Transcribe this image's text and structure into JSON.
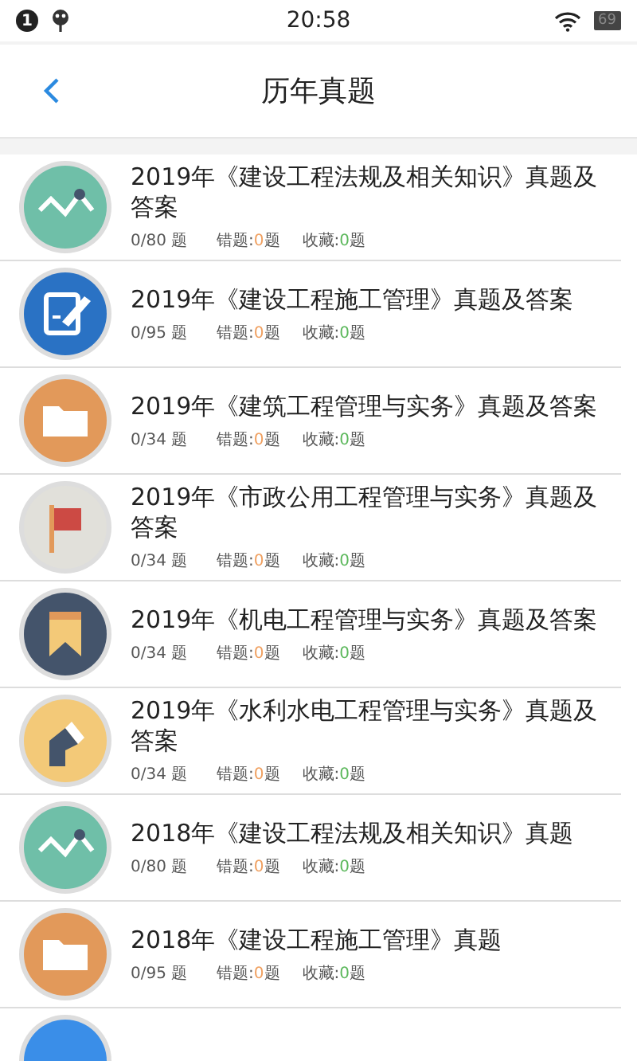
{
  "status_bar": {
    "notification_count": "1",
    "time": "20:58",
    "battery": "69"
  },
  "nav": {
    "title": "历年真题"
  },
  "items": [
    {
      "kind": "chart",
      "title": "2019年《建设工程法规及相关知识》真题及答案",
      "total": "0/80 题",
      "wrong": {
        "label": "错题:",
        "count": "0",
        "unit": "题"
      },
      "fav": {
        "label": "收藏:",
        "count": "0",
        "unit": "题"
      }
    },
    {
      "kind": "edit",
      "title": "2019年《建设工程施工管理》真题及答案",
      "total": "0/95 题",
      "wrong": {
        "label": "错题:",
        "count": "0",
        "unit": "题"
      },
      "fav": {
        "label": "收藏:",
        "count": "0",
        "unit": "题"
      }
    },
    {
      "kind": "folder",
      "title": "2019年《建筑工程管理与实务》真题及答案",
      "total": "0/34 题",
      "wrong": {
        "label": "错题:",
        "count": "0",
        "unit": "题"
      },
      "fav": {
        "label": "收藏:",
        "count": "0",
        "unit": "题"
      }
    },
    {
      "kind": "flag",
      "title": "2019年《市政公用工程管理与实务》真题及答案",
      "total": "0/34 题",
      "wrong": {
        "label": "错题:",
        "count": "0",
        "unit": "题"
      },
      "fav": {
        "label": "收藏:",
        "count": "0",
        "unit": "题"
      }
    },
    {
      "kind": "bookmark",
      "title": "2019年《机电工程管理与实务》真题及答案",
      "total": "0/34 题",
      "wrong": {
        "label": "错题:",
        "count": "0",
        "unit": "题"
      },
      "fav": {
        "label": "收藏:",
        "count": "0",
        "unit": "题"
      }
    },
    {
      "kind": "pipe",
      "title": "2019年《水利水电工程管理与实务》真题及答案",
      "total": "0/34 题",
      "wrong": {
        "label": "错题:",
        "count": "0",
        "unit": "题"
      },
      "fav": {
        "label": "收藏:",
        "count": "0",
        "unit": "题"
      }
    },
    {
      "kind": "chart",
      "title": "2018年《建设工程法规及相关知识》真题",
      "total": "0/80 题",
      "wrong": {
        "label": "错题:",
        "count": "0",
        "unit": "题"
      },
      "fav": {
        "label": "收藏:",
        "count": "0",
        "unit": "题"
      }
    },
    {
      "kind": "folder",
      "title": "2018年《建设工程施工管理》真题",
      "total": "0/95 题",
      "wrong": {
        "label": "错题:",
        "count": "0",
        "unit": "题"
      },
      "fav": {
        "label": "收藏:",
        "count": "0",
        "unit": "题"
      }
    },
    {
      "kind": "plain"
    }
  ]
}
